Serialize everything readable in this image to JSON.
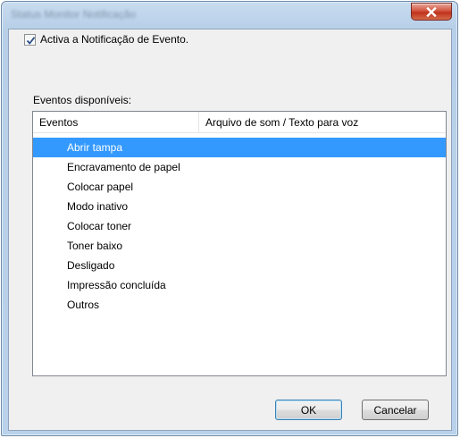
{
  "window": {
    "title": "Status Monitor Notificação"
  },
  "notification": {
    "checkbox_label": "Activa a Notificação de Evento.",
    "checked": true
  },
  "events": {
    "group_label": "Eventos disponíveis:",
    "columns": [
      "Eventos",
      "Arquivo de som / Texto para voz"
    ],
    "items": [
      "Abrir tampa",
      "Encravamento de papel",
      "Colocar papel",
      "Modo inativo",
      "Colocar toner",
      "Toner baixo",
      "Desligado",
      "Impressão concluída",
      "Outros"
    ],
    "selected_item": "Abrir tampa"
  },
  "buttons": {
    "ok_label": "OK",
    "cancel_label": "Cancelar"
  },
  "colors": {
    "selection": "#3399ff",
    "close_button": "#c7432a"
  }
}
